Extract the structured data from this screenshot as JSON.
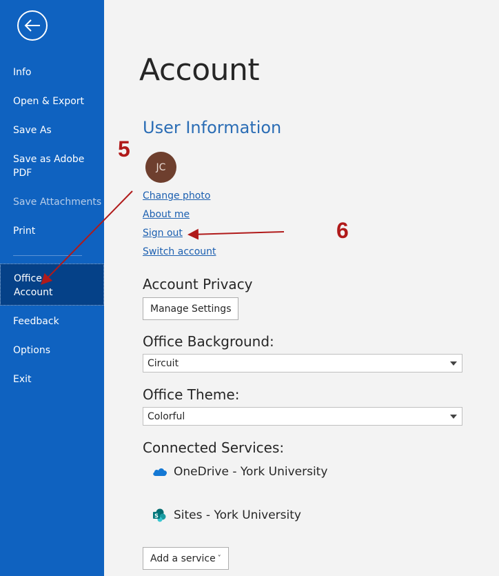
{
  "sidebar": {
    "items": [
      {
        "label": "Info"
      },
      {
        "label": "Open & Export"
      },
      {
        "label": "Save As"
      },
      {
        "label": "Save as Adobe PDF"
      },
      {
        "label": "Save Attachments"
      },
      {
        "label": "Print"
      },
      {
        "label": "Office Account"
      },
      {
        "label": "Feedback"
      },
      {
        "label": "Options"
      },
      {
        "label": "Exit"
      }
    ],
    "bg_color": "#0f62c0",
    "selected_color": "#054188"
  },
  "main": {
    "title": "Account",
    "user_info": {
      "heading": "User Information",
      "initials": "JC",
      "links": [
        "Change photo",
        "About me",
        "Sign out",
        "Switch account"
      ]
    },
    "privacy": {
      "heading": "Account Privacy",
      "button": "Manage Settings"
    },
    "background": {
      "heading": "Office Background:",
      "value": "Circuit"
    },
    "theme": {
      "heading": "Office Theme:",
      "value": "Colorful"
    },
    "services": {
      "heading": "Connected Services:",
      "items": [
        {
          "label": "OneDrive - York University",
          "icon": "onedrive-icon"
        },
        {
          "label": "Sites - York University",
          "icon": "sharepoint-icon"
        }
      ],
      "add_button": "Add a service"
    }
  },
  "annotations": {
    "step5": "5",
    "step6": "6",
    "color": "#b01a1a"
  }
}
